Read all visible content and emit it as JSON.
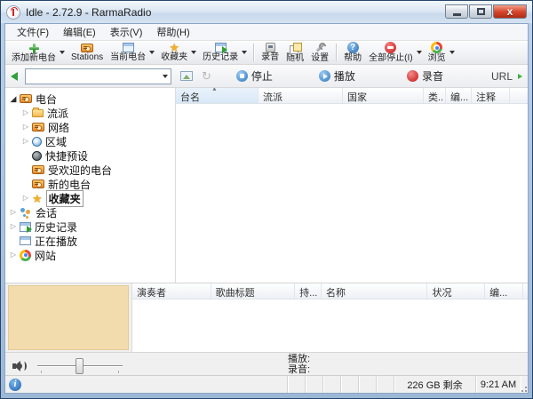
{
  "window": {
    "title": "Idle - 2.72.9 - RarmaRadio",
    "controls": {
      "close_glyph": "x"
    }
  },
  "menubar": {
    "items": [
      {
        "label": "文件(F)"
      },
      {
        "label": "编辑(E)"
      },
      {
        "label": "表示(V)"
      },
      {
        "label": "帮助(H)"
      }
    ]
  },
  "toolbar1": {
    "add_station": "添加新电台",
    "stations": "Stations",
    "current_station": "当前电台",
    "favorites": "收藏夹",
    "history": "历史记录",
    "record": "录音",
    "random": "随机",
    "settings": "设置",
    "help": "帮助",
    "stop_all": "全部停止(I)",
    "browse": "浏览"
  },
  "toolbar2": {
    "address_value": "",
    "stop": "停止",
    "play": "播放",
    "record": "录音",
    "url_label": "URL"
  },
  "tree": {
    "items": [
      {
        "label": "电台"
      },
      {
        "label": "流派"
      },
      {
        "label": "网络"
      },
      {
        "label": "区域"
      },
      {
        "label": "快捷预设"
      },
      {
        "label": "受欢迎的电台"
      },
      {
        "label": "新的电台"
      },
      {
        "label": "收藏夹"
      },
      {
        "label": "会话"
      },
      {
        "label": "历史记录"
      },
      {
        "label": "正在播放"
      },
      {
        "label": "网站"
      }
    ]
  },
  "station_table": {
    "columns": {
      "name": "台名",
      "genre": "流派",
      "country": "国家",
      "type": "类..",
      "encoding": "编...",
      "comment": "注释"
    },
    "rows": []
  },
  "track_table": {
    "columns": {
      "artist": "演奏者",
      "title": "歌曲标题",
      "duration": "持...",
      "name": "名称",
      "status": "状况",
      "encoding": "编..."
    },
    "rows": []
  },
  "playback": {
    "play_label": "播放:",
    "play_value": "",
    "record_label": "录音:",
    "record_value": ""
  },
  "statusbar": {
    "disk_free": "226 GB 剩余",
    "time": "9:21 AM"
  },
  "colors": {
    "accent_blue": "#2a77c0",
    "record_red": "#c41616",
    "frame_blue": "#9cb8d6",
    "art_beige": "#f2dcae"
  }
}
